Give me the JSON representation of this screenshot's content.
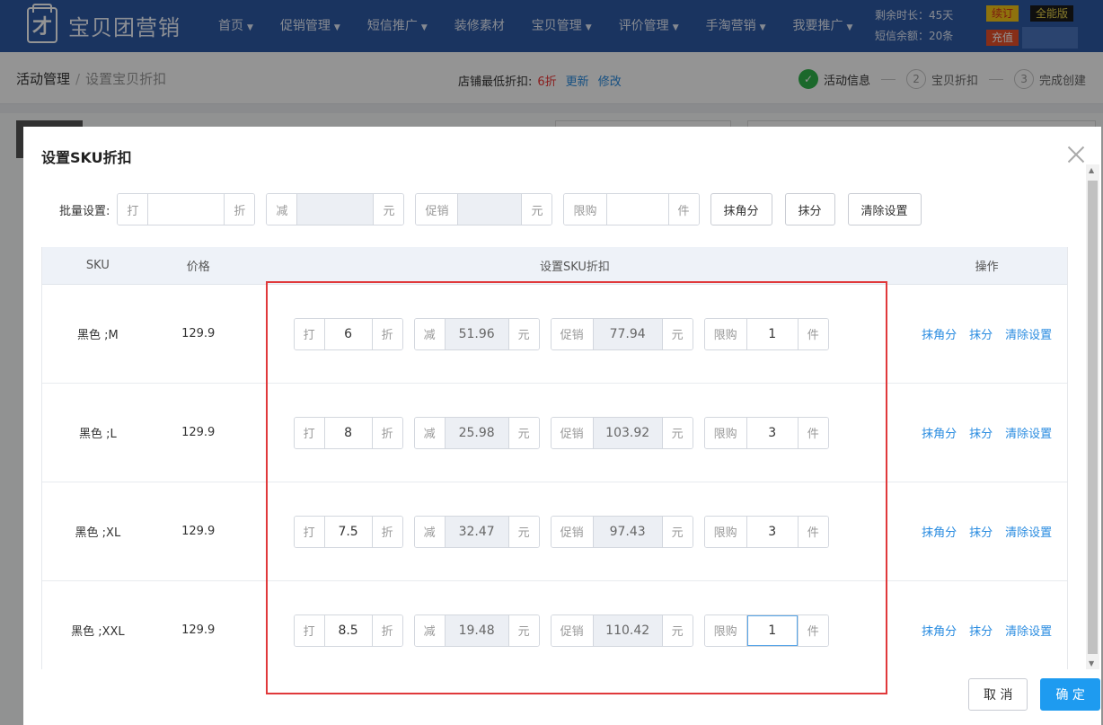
{
  "topbar": {
    "logo_icon": "才",
    "logo_text": "宝贝团营销",
    "nav": [
      "首页",
      "促销管理",
      "短信推广",
      "装修素材",
      "宝贝管理",
      "评价管理",
      "手淘营销",
      "我要推广"
    ],
    "nav_has_caret": [
      true,
      true,
      true,
      false,
      true,
      true,
      true,
      true
    ],
    "remaining_time": "剩余时长：45天",
    "sms_balance": "短信余额：20条",
    "renew": "续订",
    "edition": "全能版",
    "recharge": "充值"
  },
  "subheader": {
    "breadcrumb": [
      "活动管理",
      "设置宝贝折扣"
    ],
    "shop_min_label": "店铺最低折扣:",
    "shop_min_value": "6折",
    "refresh": "更新",
    "edit": "修改",
    "steps": [
      {
        "num": "✓",
        "label": "活动信息",
        "done": true
      },
      {
        "num": "2",
        "label": "宝贝折扣",
        "done": false
      },
      {
        "num": "3",
        "label": "完成创建",
        "done": false
      }
    ]
  },
  "modal": {
    "title": "设置SKU折扣",
    "batch": {
      "label": "批量设置:",
      "discount": {
        "prefix": "打",
        "value": "",
        "suffix": "折"
      },
      "reduce": {
        "prefix": "减",
        "value": "",
        "suffix": "元"
      },
      "promo": {
        "prefix": "促销",
        "value": "",
        "suffix": "元"
      },
      "limit": {
        "prefix": "限购",
        "value": "",
        "suffix": "件"
      },
      "buttons": [
        "抹角分",
        "抹分",
        "清除设置"
      ]
    },
    "table": {
      "headers": [
        "SKU",
        "价格",
        "设置SKU折扣",
        "操作"
      ],
      "rows": [
        {
          "sku": "黑色 ;M",
          "price": "129.9",
          "discount": "6",
          "reduce": "51.96",
          "promo": "77.94",
          "limit": "1"
        },
        {
          "sku": "黑色 ;L",
          "price": "129.9",
          "discount": "8",
          "reduce": "25.98",
          "promo": "103.92",
          "limit": "3"
        },
        {
          "sku": "黑色 ;XL",
          "price": "129.9",
          "discount": "7.5",
          "reduce": "32.47",
          "promo": "97.43",
          "limit": "3"
        },
        {
          "sku": "黑色 ;XXL",
          "price": "129.9",
          "discount": "8.5",
          "reduce": "19.48",
          "promo": "110.42",
          "limit": "1"
        }
      ],
      "labels": {
        "da": "打",
        "zhe": "折",
        "jian": "减",
        "yuan": "元",
        "cuxiao": "促销",
        "xiangou": "限购",
        "jian_unit": "件"
      },
      "row_actions": [
        "抹角分",
        "抹分",
        "清除设置"
      ]
    },
    "footer": {
      "cancel": "取 消",
      "confirm": "确 定"
    }
  },
  "colors": {
    "nav_bg": "#2e5aa6",
    "link": "#2a8ce0",
    "primary": "#1e9bf0",
    "highlight": "#e0393b",
    "done": "#2fb44a"
  }
}
